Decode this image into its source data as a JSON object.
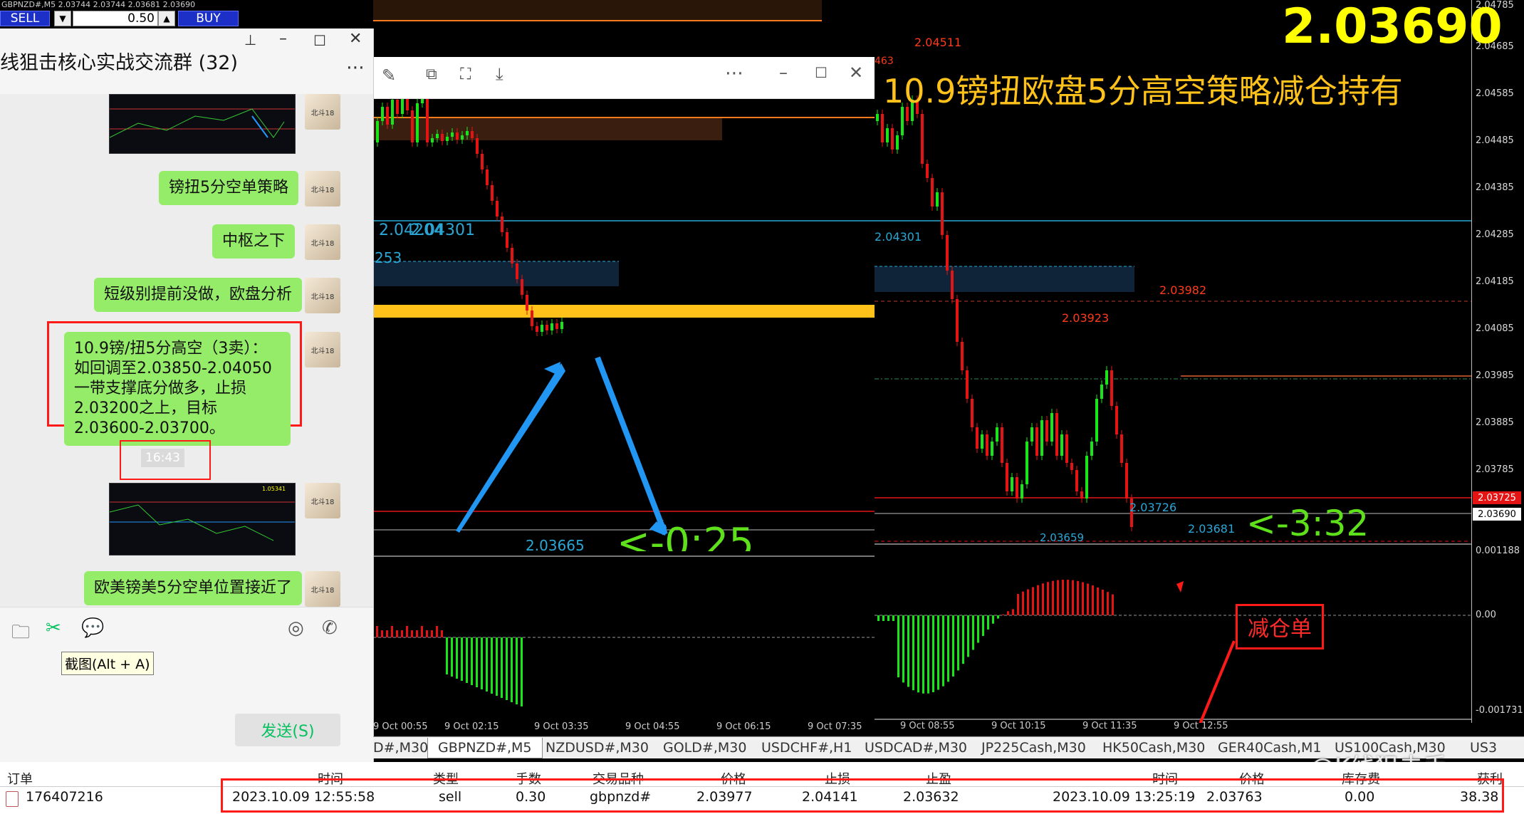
{
  "terminal": {
    "symbol_line": "GBPNZD#,M5  2.03744 2.03744 2.03681 2.03690",
    "sell_label": "SELL",
    "buy_label": "BUY",
    "lot": "0.50"
  },
  "chat": {
    "title": "线狙击核心实战交流群 (32)",
    "messages": [
      {
        "text": "镑扭5分空单策略"
      },
      {
        "text": "中枢之下"
      },
      {
        "text": "短级别提前没做，欧盘分析"
      },
      {
        "text": "10.9镑/扭5分高空（3卖）：如回调至2.03850-2.04050一带支撑底分做多，止损2.03200之上，目标2.03600-2.03700。"
      },
      {
        "text": "欧美镑美5分空单位置接近了"
      }
    ],
    "timestamp": "16:43",
    "thumb_price": "1.05341",
    "avatar_text": "北斗18",
    "tooltip": "截图(Alt + A)",
    "send_label": "发送(S)"
  },
  "viewer": {
    "price_labels": [
      "2.04204",
      "2.04301",
      "253",
      "2.03665"
    ],
    "countdown": "<-0:25",
    "time_labels": [
      "9 Oct 00:55",
      "9 Oct 02:15",
      "9 Oct 03:35",
      "9 Oct 04:55",
      "9 Oct 06:15",
      "9 Oct 07:35"
    ],
    "edge_label": "463"
  },
  "chart": {
    "big_price": "2.03690",
    "headline": "10.9镑扭欧盘5分高空策略减仓持有",
    "labels": {
      "high": "2.04511",
      "l1": "2.04301",
      "r1": "2.03982",
      "r2": "2.03923",
      "low1": "2.03659",
      "low2": "2.03726",
      "low3": "2.03681"
    },
    "countdown": "<-3:32",
    "reduce_label": "减仓单",
    "time_labels": [
      "9 Oct 08:55",
      "9 Oct 10:15",
      "9 Oct 11:35",
      "9 Oct 12:55"
    ],
    "axis": [
      "2.04685",
      "2.04585",
      "2.04485",
      "2.04385",
      "2.04285",
      "2.04185",
      "2.04085",
      "2.03985",
      "2.03885",
      "2.03785",
      "2.03725",
      "2.03690",
      "0.001188",
      "0.00",
      "-0.001731"
    ],
    "top_tick": "2.04785"
  },
  "tabs": [
    "D#,M30",
    "GBPNZD#,M5",
    "NZDUSD#,M30",
    "GOLD#,M30",
    "USDCHF#,H1",
    "USDCAD#,M30",
    "JP225Cash,M30",
    "HK50Cash,M30",
    "GER40Cash,M1",
    "US100Cash,M30",
    "US3"
  ],
  "watermark": "@K线狙击手",
  "orders": {
    "headers": [
      "订单",
      "时间",
      "类型",
      "手数",
      "交易品种",
      "价格",
      "止损",
      "止盈",
      "时间",
      "价格",
      "库存费",
      "获利"
    ],
    "row": [
      "176407216",
      "2023.10.09 12:55:58",
      "sell",
      "0.30",
      "gbpnzd#",
      "2.03977",
      "2.04141",
      "2.03632",
      "2023.10.09 13:25:19",
      "2.03763",
      "0.00",
      "38.38"
    ]
  },
  "colors": {
    "bull": "#19e619",
    "bear": "#e51414",
    "accent": "#ffc21a",
    "price": "#ffff00"
  }
}
